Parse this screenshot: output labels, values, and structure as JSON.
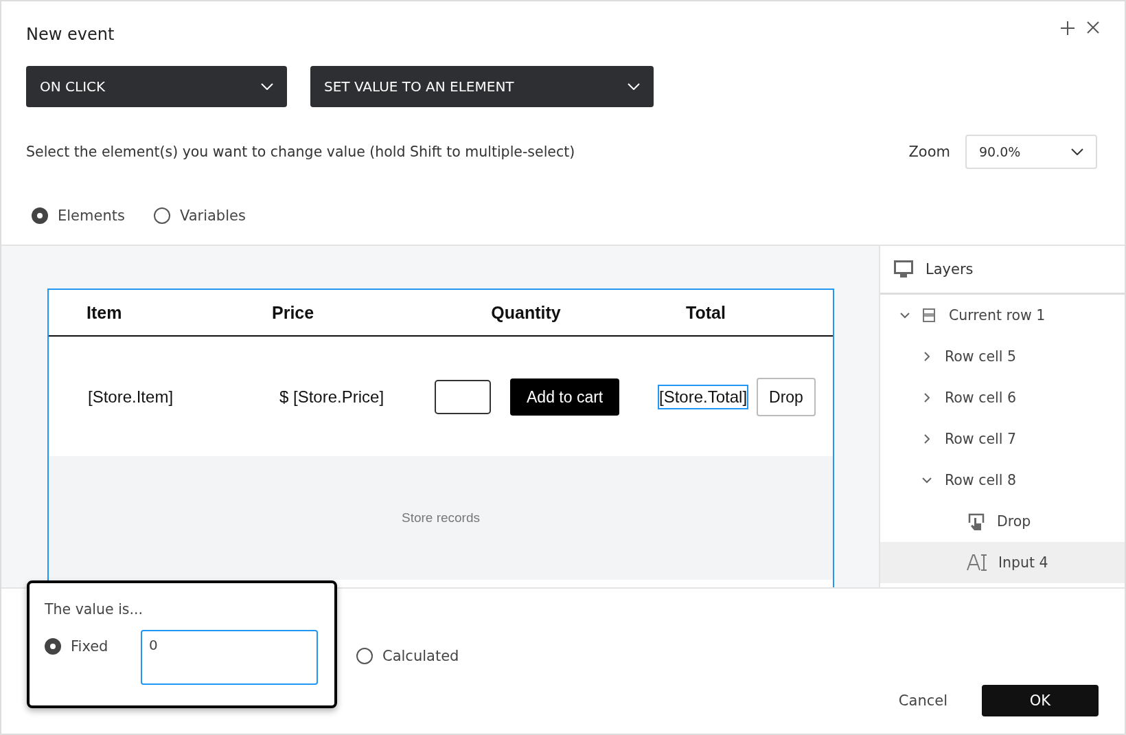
{
  "dialog": {
    "title": "New event"
  },
  "trigger_dropdown": {
    "value": "ON CLICK"
  },
  "action_dropdown": {
    "value": "SET VALUE TO AN ELEMENT"
  },
  "instruction": "Select the element(s) you want to change value (hold Shift to multiple-select)",
  "zoom": {
    "label": "Zoom",
    "value": "90.0%"
  },
  "target_options": [
    {
      "label": "Elements",
      "selected": true
    },
    {
      "label": "Variables",
      "selected": false
    }
  ],
  "table": {
    "columns": [
      "Item",
      "Price",
      "Quantity",
      "Total"
    ],
    "row": [
      [
        {
          "kind": "text",
          "text": "[Store.Item]",
          "selected": false
        }
      ],
      [
        {
          "kind": "text",
          "text": "$ [Store.Price]",
          "selected": false
        }
      ],
      [
        {
          "kind": "input",
          "selected": false
        },
        {
          "kind": "dark-button",
          "text": "Add to cart",
          "selected": false
        }
      ],
      [
        {
          "kind": "text",
          "text": "[Store.Total]",
          "selected": true
        },
        {
          "kind": "button",
          "text": "Drop",
          "selected": false
        }
      ]
    ],
    "records_label": "Store records"
  },
  "layers": {
    "title": "Layers",
    "tree": [
      {
        "label": "Current row 1",
        "kind": "row",
        "expanded": true,
        "selected": false,
        "children": [
          {
            "label": "Row cell 5",
            "expanded": false,
            "selected": false
          },
          {
            "label": "Row cell 6",
            "expanded": false,
            "selected": false
          },
          {
            "label": "Row cell 7",
            "expanded": false,
            "selected": false
          },
          {
            "label": "Row cell 8",
            "expanded": true,
            "selected": false,
            "children": [
              {
                "label": "Drop",
                "kind": "button",
                "selected": false
              },
              {
                "label": "Input 4",
                "kind": "input",
                "selected": true
              }
            ]
          }
        ]
      }
    ]
  },
  "value_panel": {
    "title": "The value is...",
    "options": [
      {
        "label": "Fixed",
        "kind": "fixed",
        "selected": true,
        "value": "0"
      },
      {
        "label": "Calculated",
        "kind": "calculated",
        "selected": false
      }
    ]
  },
  "buttons": [
    {
      "label": "Cancel",
      "kind": "secondary"
    },
    {
      "label": "OK",
      "kind": "primary"
    }
  ]
}
